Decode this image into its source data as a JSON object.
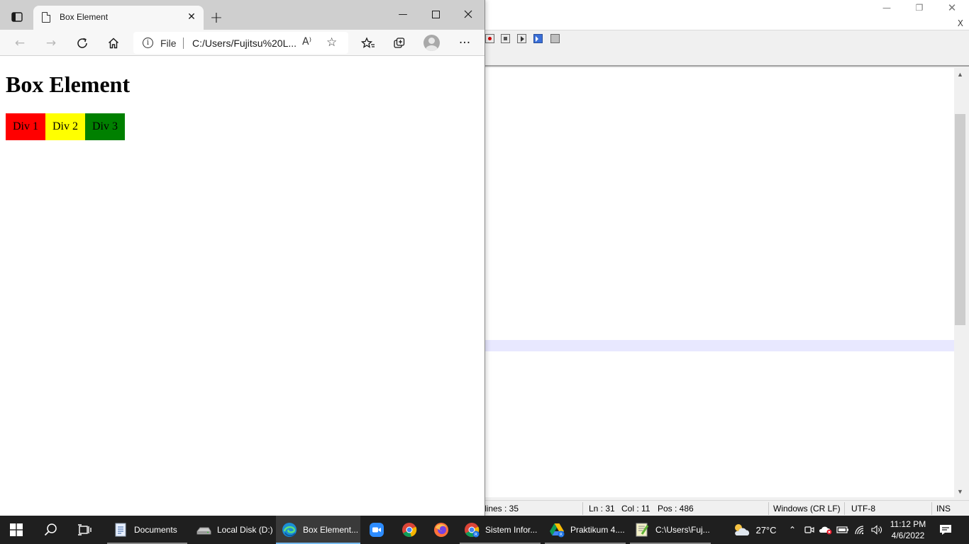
{
  "editor_window": {
    "menu_close": "X",
    "status": {
      "lines": "lines : 35",
      "ln": "Ln : 31",
      "col": "Col : 11",
      "pos": "Pos : 486",
      "eol": "Windows (CR LF)",
      "encoding": "UTF-8",
      "mode": "INS"
    }
  },
  "browser": {
    "tab": {
      "title": "Box Element"
    },
    "address": {
      "scheme_label": "File",
      "url": "C:/Users/Fujitsu%20L..."
    },
    "page": {
      "heading": "Box Element",
      "boxes": [
        {
          "label": "Div 1",
          "color": "#ff0000"
        },
        {
          "label": "Div 2",
          "color": "#ffff00"
        },
        {
          "label": "Div 3",
          "color": "#008000"
        }
      ]
    }
  },
  "taskbar": {
    "apps": [
      {
        "label": "Documents"
      },
      {
        "label": "Local Disk (D:)"
      },
      {
        "label": "Box Element..."
      },
      {
        "label": "Sistem Infor..."
      },
      {
        "label": "Praktikum 4...."
      },
      {
        "label": "C:\\Users\\Fuj..."
      }
    ],
    "weather": "27°C",
    "time": "11:12 PM",
    "date": "4/6/2022"
  }
}
